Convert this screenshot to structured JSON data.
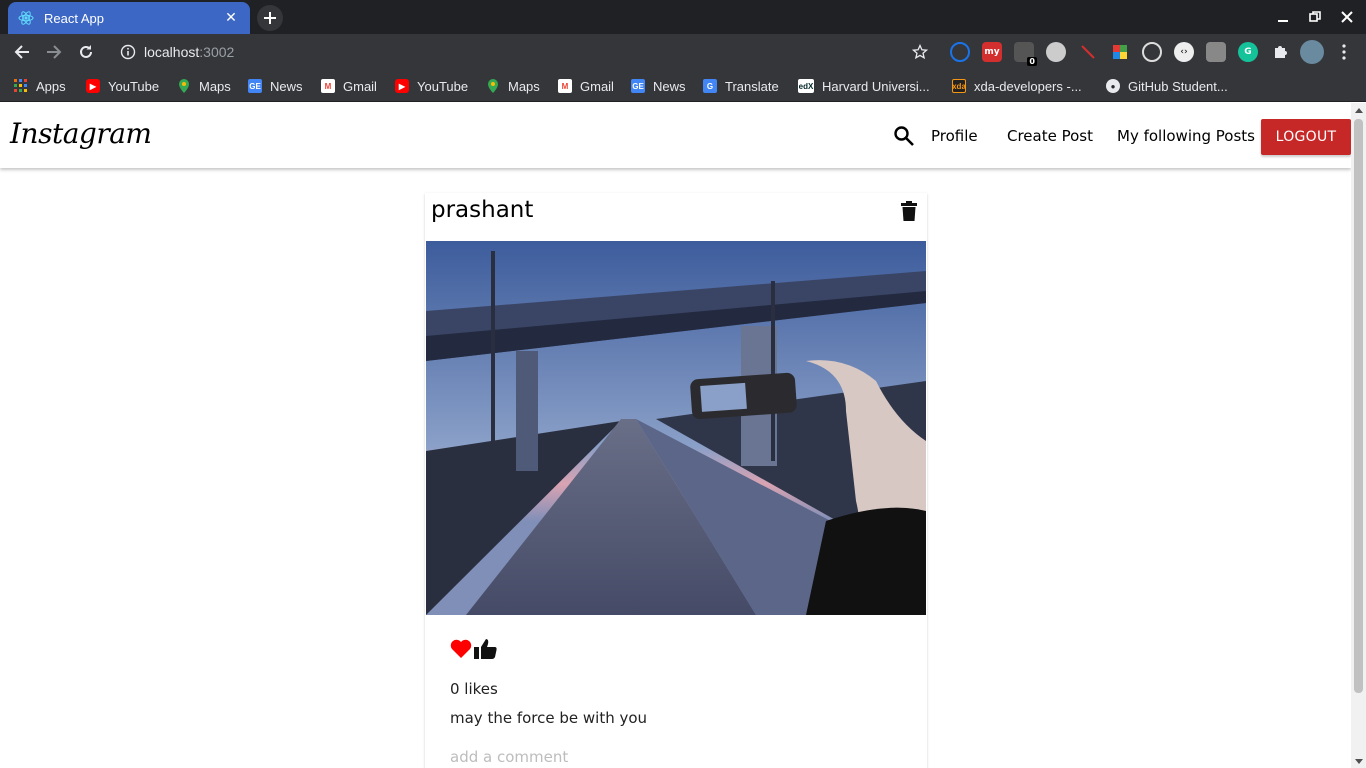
{
  "browser": {
    "tab_title": "React App",
    "url_host": "localhost",
    "url_port": ":3002",
    "bookmarks": [
      {
        "label": "Apps",
        "icon": "apps-grid-icon"
      },
      {
        "label": "YouTube",
        "icon": "youtube-icon"
      },
      {
        "label": "Maps",
        "icon": "maps-icon"
      },
      {
        "label": "News",
        "icon": "news-icon"
      },
      {
        "label": "Gmail",
        "icon": "gmail-icon"
      },
      {
        "label": "YouTube",
        "icon": "youtube-icon"
      },
      {
        "label": "Maps",
        "icon": "maps-icon"
      },
      {
        "label": "Gmail",
        "icon": "gmail-icon"
      },
      {
        "label": "News",
        "icon": "news-icon"
      },
      {
        "label": "Translate",
        "icon": "translate-icon"
      },
      {
        "label": "Harvard Universi...",
        "icon": "edx-icon"
      },
      {
        "label": "xda-developers -...",
        "icon": "xda-icon"
      },
      {
        "label": "GitHub Student...",
        "icon": "github-icon"
      }
    ],
    "extension_badge": "0"
  },
  "app": {
    "brand": "Instagram",
    "nav": {
      "profile": "Profile",
      "create_post": "Create Post",
      "following_posts": "My following Posts",
      "logout": "LOGOUT"
    },
    "colors": {
      "logout_bg": "#c62828",
      "like_heart": "#ff0000"
    }
  },
  "post": {
    "username": "prashant",
    "likes_text": "0 likes",
    "caption": "may the force be with you",
    "comment_placeholder": "add a comment"
  }
}
